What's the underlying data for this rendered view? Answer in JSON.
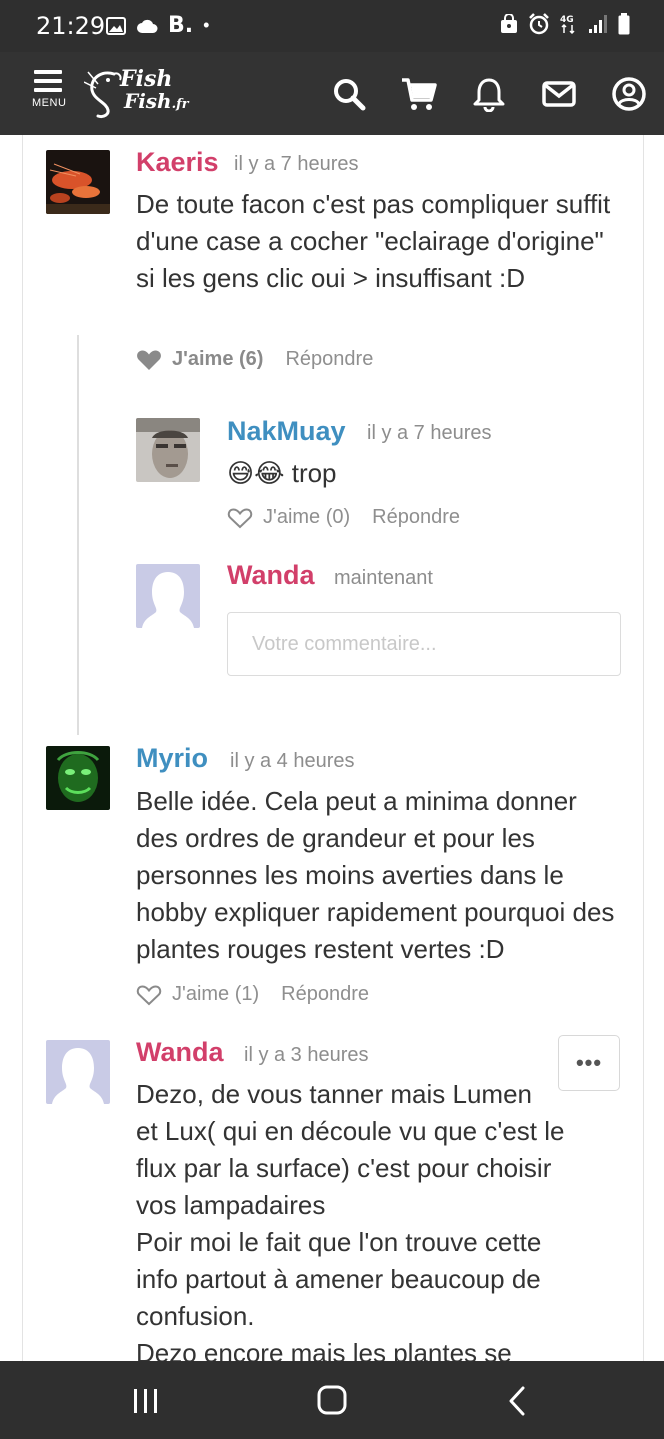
{
  "status_bar": {
    "time": "21:29",
    "carrier_letter": "B.",
    "dot": "•",
    "network": "4G"
  },
  "header": {
    "menu_label": "MENU",
    "logo_line1": "Fish",
    "logo_line2": "Fish",
    "logo_suffix": ".fr"
  },
  "comments": [
    {
      "author": "Kaeris",
      "time": "il y a 7 heures",
      "text": "De toute facon c'est pas compliquer suffit d'une case a cocher \"eclairage d'origine\" si les gens clic oui > insuffisant :D",
      "like_label": "J'aime (6)",
      "reply_label": "Répondre",
      "liked": true
    },
    {
      "author": "NakMuay",
      "time": "il y a 7 heures",
      "emoji": "😅😂",
      "text": "trop",
      "like_label": "J'aime (0)",
      "reply_label": "Répondre"
    },
    {
      "author": "Wanda",
      "time": "maintenant",
      "input_placeholder": "Votre commentaire..."
    },
    {
      "author": "Myrio",
      "time": "il y a 4 heures",
      "text": "Belle idée. Cela peut a minima donner des ordres de grandeur et pour les personnes les moins averties dans le hobby expliquer rapidement pourquoi des plantes rouges restent vertes :D",
      "like_label": "J'aime (1)",
      "reply_label": "Répondre"
    },
    {
      "author": "Wanda",
      "time": "il y a 3 heures",
      "more_label": "•••",
      "text_lines": [
        "Dezo, de vous tanner mais Lumen",
        "et Lux( qui en découle vu que c'est le",
        "flux par la surface) c'est pour choisir",
        "vos lampadaires",
        "Poir moi le fait que l'on trouve cette",
        "info partout à amener beaucoup de",
        "confusion.",
        "Dezo encore mais les plantes se"
      ]
    }
  ],
  "colors": {
    "author_pink": "#d23f6a",
    "author_blue": "#3f8fc0",
    "bar_dark": "#333333"
  }
}
